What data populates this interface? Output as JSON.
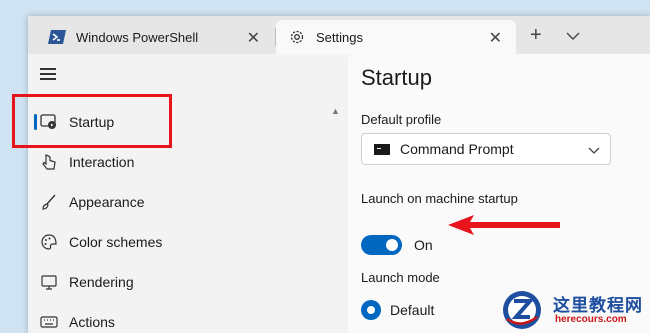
{
  "tabs": [
    {
      "title": "Windows PowerShell",
      "icon": "powershell-icon"
    },
    {
      "title": "Settings",
      "icon": "gear-icon"
    }
  ],
  "sidebar": {
    "items": [
      {
        "label": "Startup",
        "icon": "startup-icon",
        "active": true
      },
      {
        "label": "Interaction",
        "icon": "pointer-icon"
      },
      {
        "label": "Appearance",
        "icon": "brush-icon"
      },
      {
        "label": "Color schemes",
        "icon": "palette-icon"
      },
      {
        "label": "Rendering",
        "icon": "monitor-icon"
      },
      {
        "label": "Actions",
        "icon": "keyboard-icon"
      }
    ]
  },
  "main": {
    "title": "Startup",
    "default_profile": {
      "label": "Default profile",
      "value": "Command Prompt"
    },
    "launch_startup": {
      "label": "Launch on machine startup",
      "state": "On",
      "enabled": true
    },
    "launch_mode": {
      "label": "Launch mode",
      "selected": "Default"
    }
  },
  "watermark": {
    "text_cn": "这里教程网",
    "url": "herecours.com"
  },
  "colors": {
    "accent": "#0067c0",
    "annotation": "#e8141c"
  }
}
